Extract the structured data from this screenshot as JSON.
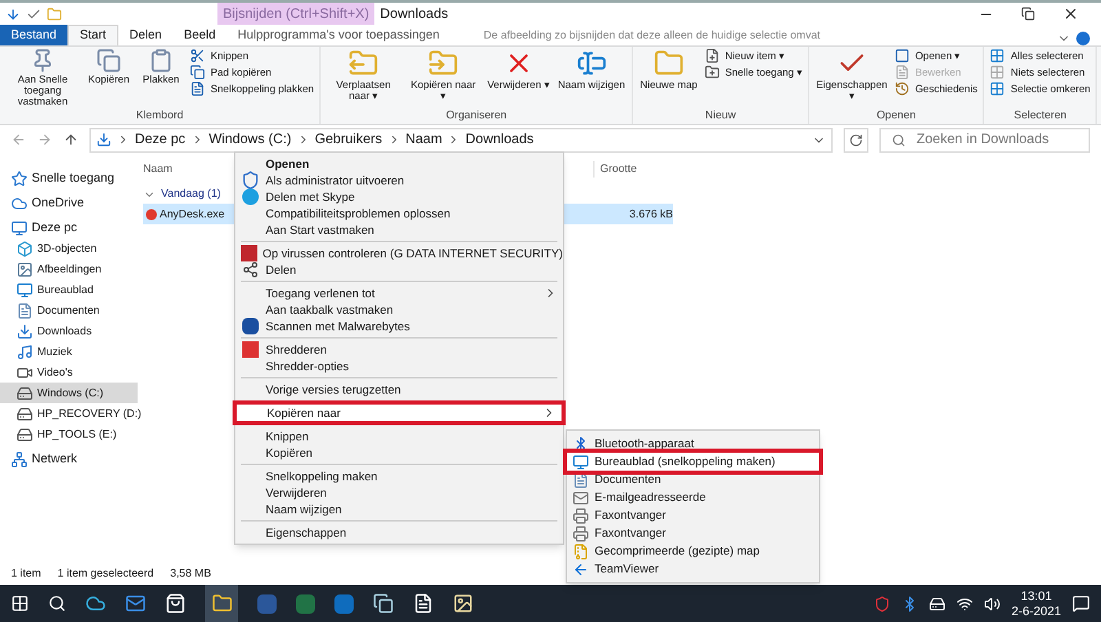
{
  "window": {
    "title": "Downloads"
  },
  "tooltip": {
    "title": "Bijsnijden (Ctrl+Shift+X)",
    "text": "De afbeelding zo bijsnijden dat deze alleen de huidige selectie omvat"
  },
  "ribbon_tabs": [
    {
      "label": "Bestand",
      "kind": "file",
      "selected": false
    },
    {
      "label": "Start",
      "kind": "tab",
      "selected": true
    },
    {
      "label": "Delen",
      "kind": "tab",
      "selected": false
    },
    {
      "label": "Beeld",
      "kind": "tab",
      "selected": false
    },
    {
      "label": "Hulpprogramma's voor toepassingen",
      "kind": "context",
      "selected": false
    }
  ],
  "ribbon_groups": [
    {
      "label": "Klembord",
      "large": [
        {
          "label": "Aan Snelle toegang vastmaken",
          "disabled": false
        },
        {
          "label": "Kopiëren",
          "disabled": false
        },
        {
          "label": "Plakken",
          "disabled": false
        }
      ],
      "small": [
        {
          "label": "Knippen",
          "disabled": false
        },
        {
          "label": "Pad kopiëren",
          "disabled": false
        },
        {
          "label": "Snelkoppeling plakken",
          "disabled": false
        }
      ]
    },
    {
      "label": "Organiseren",
      "large": [
        {
          "label": "Verplaatsen naar ▾",
          "disabled": false
        },
        {
          "label": "Kopiëren naar ▾",
          "disabled": false
        },
        {
          "label": "Verwijderen ▾",
          "disabled": false
        },
        {
          "label": "Naam wijzigen",
          "disabled": false
        }
      ]
    },
    {
      "label": "Nieuw",
      "large": [
        {
          "label": "Nieuwe map",
          "disabled": false
        }
      ],
      "small": [
        {
          "label": "Nieuw item ▾",
          "disabled": false
        },
        {
          "label": "Snelle toegang ▾",
          "disabled": false
        }
      ]
    },
    {
      "label": "Openen",
      "large": [
        {
          "label": "Eigenschappen ▾",
          "disabled": false
        }
      ],
      "small": [
        {
          "label": "Openen ▾",
          "disabled": false
        },
        {
          "label": "Bewerken",
          "disabled": true
        },
        {
          "label": "Geschiedenis",
          "disabled": false
        }
      ]
    },
    {
      "label": "Selecteren",
      "small": [
        {
          "label": "Alles selecteren",
          "disabled": false
        },
        {
          "label": "Niets selecteren",
          "disabled": false
        },
        {
          "label": "Selectie omkeren",
          "disabled": false
        }
      ]
    }
  ],
  "address_bar": {
    "crumbs": [
      "Deze pc",
      "Windows (C:)",
      "Gebruikers",
      "Naam",
      "Downloads"
    ]
  },
  "search": {
    "placeholder": "Zoeken in Downloads"
  },
  "sidebar": {
    "items": [
      {
        "label": "Snelle toegang",
        "selected": false
      },
      {
        "label": "OneDrive",
        "selected": false
      },
      {
        "label": "Deze pc",
        "selected": false,
        "children": [
          {
            "label": "3D-objecten",
            "selected": false
          },
          {
            "label": "Afbeeldingen",
            "selected": false
          },
          {
            "label": "Bureaublad",
            "selected": false
          },
          {
            "label": "Documenten",
            "selected": false
          },
          {
            "label": "Downloads",
            "selected": false
          },
          {
            "label": "Muziek",
            "selected": false
          },
          {
            "label": "Video's",
            "selected": false
          },
          {
            "label": "Windows (C:)",
            "selected": true
          },
          {
            "label": "HP_RECOVERY (D:)",
            "selected": false
          },
          {
            "label": "HP_TOOLS (E:)",
            "selected": false
          }
        ]
      },
      {
        "label": "Netwerk",
        "selected": false
      }
    ]
  },
  "file_list": {
    "columns": [
      "Naam",
      "Grootte"
    ],
    "group": "Vandaag (1)",
    "rows": [
      {
        "name": "AnyDesk.exe",
        "size": "3.676 kB",
        "selected": true
      }
    ]
  },
  "context_menu": [
    {
      "kind": "item",
      "label": "Openen",
      "default": true,
      "has_submenu": false,
      "highlighted": false
    },
    {
      "kind": "item",
      "label": "Als administrator uitvoeren",
      "default": false,
      "has_submenu": false,
      "highlighted": false
    },
    {
      "kind": "item",
      "label": "Delen met Skype",
      "default": false,
      "has_submenu": false,
      "highlighted": false
    },
    {
      "kind": "item",
      "label": "Compatibiliteitsproblemen oplossen",
      "default": false,
      "has_submenu": false,
      "highlighted": false
    },
    {
      "kind": "item",
      "label": "Aan Start vastmaken",
      "default": false,
      "has_submenu": false,
      "highlighted": false
    },
    {
      "kind": "separator"
    },
    {
      "kind": "item",
      "label": "Op virussen controleren (G DATA INTERNET SECURITY)",
      "default": false,
      "has_submenu": false,
      "highlighted": false
    },
    {
      "kind": "item",
      "label": "Delen",
      "default": false,
      "has_submenu": false,
      "highlighted": false
    },
    {
      "kind": "separator"
    },
    {
      "kind": "item",
      "label": "Toegang verlenen tot",
      "default": false,
      "has_submenu": true,
      "highlighted": false
    },
    {
      "kind": "item",
      "label": "Aan taakbalk vastmaken",
      "default": false,
      "has_submenu": false,
      "highlighted": false
    },
    {
      "kind": "item",
      "label": "Scannen met Malwarebytes",
      "default": false,
      "has_submenu": false,
      "highlighted": false
    },
    {
      "kind": "separator"
    },
    {
      "kind": "item",
      "label": "Shredderen",
      "default": false,
      "has_submenu": false,
      "highlighted": false
    },
    {
      "kind": "item",
      "label": "Shredder-opties",
      "default": false,
      "has_submenu": false,
      "highlighted": false
    },
    {
      "kind": "separator"
    },
    {
      "kind": "item",
      "label": "Vorige versies terugzetten",
      "default": false,
      "has_submenu": false,
      "highlighted": false
    },
    {
      "kind": "separator"
    },
    {
      "kind": "item",
      "label": "Kopiëren naar",
      "default": false,
      "has_submenu": true,
      "highlighted": true
    },
    {
      "kind": "separator"
    },
    {
      "kind": "item",
      "label": "Knippen",
      "default": false,
      "has_submenu": false,
      "highlighted": false
    },
    {
      "kind": "item",
      "label": "Kopiëren",
      "default": false,
      "has_submenu": false,
      "highlighted": false
    },
    {
      "kind": "separator"
    },
    {
      "kind": "item",
      "label": "Snelkoppeling maken",
      "default": false,
      "has_submenu": false,
      "highlighted": false
    },
    {
      "kind": "item",
      "label": "Verwijderen",
      "default": false,
      "has_submenu": false,
      "highlighted": false
    },
    {
      "kind": "item",
      "label": "Naam wijzigen",
      "default": false,
      "has_submenu": false,
      "highlighted": false
    },
    {
      "kind": "separator"
    },
    {
      "kind": "item",
      "label": "Eigenschappen",
      "default": false,
      "has_submenu": false,
      "highlighted": false
    }
  ],
  "submenu": [
    {
      "label": "Bluetooth-apparaat",
      "highlighted": false
    },
    {
      "label": "Bureaublad (snelkoppeling maken)",
      "highlighted": true
    },
    {
      "label": "Documenten",
      "highlighted": false
    },
    {
      "label": "E-mailgeadresseerde",
      "highlighted": false
    },
    {
      "label": "Faxontvanger",
      "highlighted": false
    },
    {
      "label": "Faxontvanger",
      "highlighted": false
    },
    {
      "label": "Gecomprimeerde (gezipte) map",
      "highlighted": false
    },
    {
      "label": "TeamViewer",
      "highlighted": false
    }
  ],
  "status_bar": {
    "items": [
      "1 item",
      "1 item geselecteerd",
      "3,58 MB"
    ]
  },
  "taskbar": {
    "time": "13:01",
    "date": "2-6-2021"
  }
}
